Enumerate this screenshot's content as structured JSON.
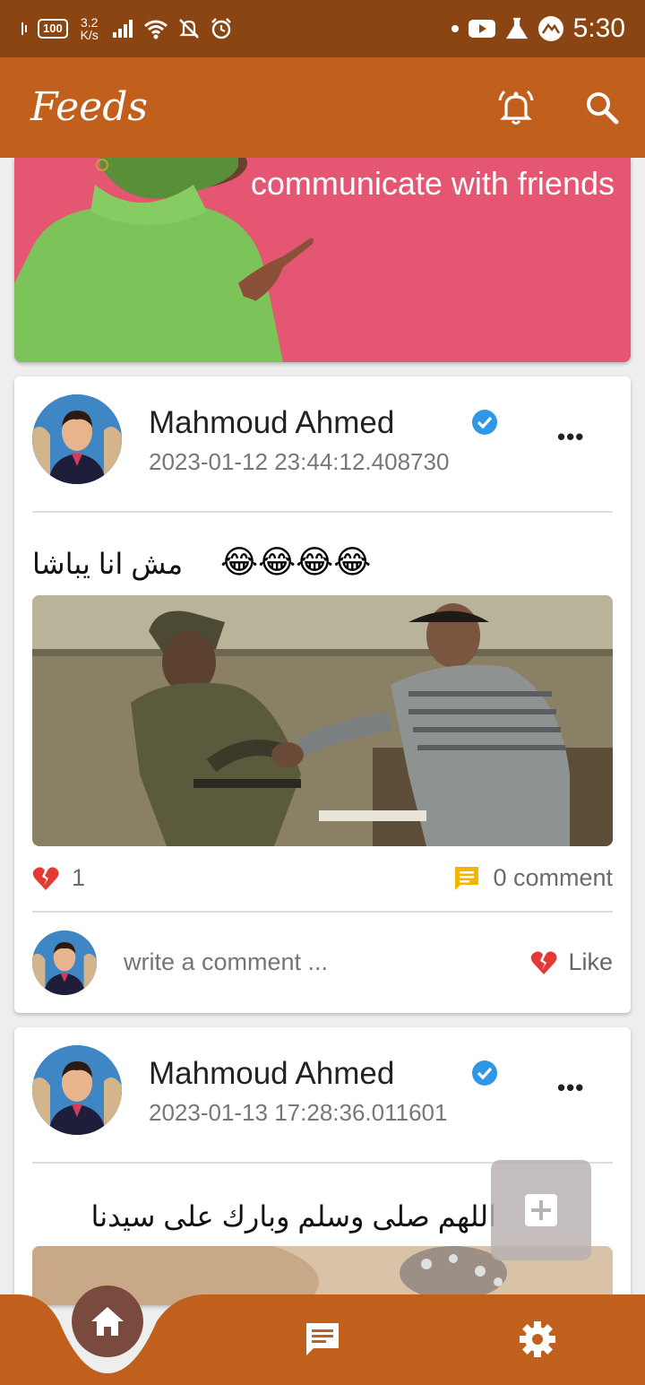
{
  "status_bar": {
    "battery": "100",
    "net_speed_value": "3.2",
    "net_speed_unit": "K/s",
    "time": "5:30",
    "icons": [
      "vibrate-icon",
      "battery-icon",
      "signal-icon",
      "wifi-icon",
      "mute-icon",
      "alarm-icon",
      "dot-icon",
      "youtube-icon",
      "flask-icon",
      "app-icon"
    ]
  },
  "appbar": {
    "title": "Feeds",
    "icons": [
      "notification-bell-icon",
      "search-icon"
    ]
  },
  "banner": {
    "text": "communicate with friends"
  },
  "posts": [
    {
      "author": "Mahmoud Ahmed",
      "timestamp": "2023-01-12 23:44:12.408730",
      "text": "مش انا يباشا",
      "emoji": "😂😂😂😂",
      "likes": "1",
      "comments": "0 comment",
      "comment_placeholder": "write a comment ...",
      "like_label": "Like"
    },
    {
      "author": "Mahmoud Ahmed",
      "timestamp": "2023-01-13 17:28:36.011601",
      "text": "اللهم صلى وسلم وبارك على سيدنا محمد"
    }
  ],
  "colors": {
    "status_bar": "#8b4513",
    "appbar": "#c15f1c",
    "banner": "#e45672",
    "verified": "#2f97e6",
    "like_heart": "#e53935",
    "comment_icon": "#f5b400",
    "home_button": "#7b4a3e",
    "nav_bar": "#c15f1c"
  },
  "bottom_nav": {
    "items": [
      "home-icon",
      "chat-icon",
      "settings-icon"
    ],
    "active": "home-icon"
  },
  "fab": {
    "icon": "add-icon"
  }
}
